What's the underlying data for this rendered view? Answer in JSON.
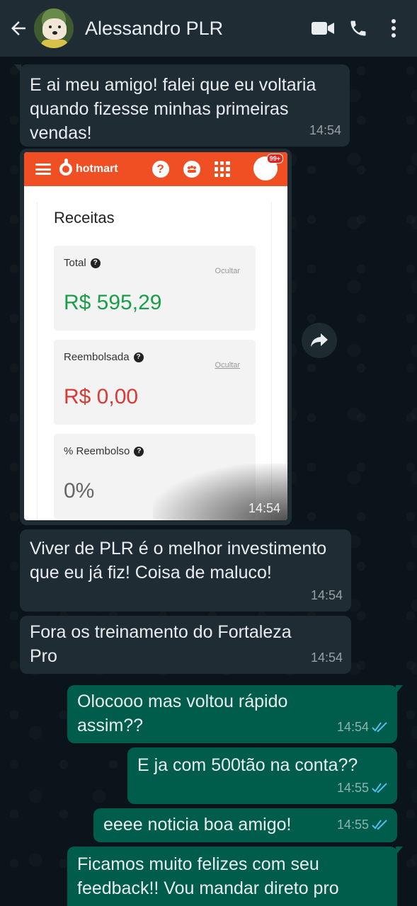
{
  "header": {
    "contact_name": "Alessandro PLR"
  },
  "messages": [
    {
      "dir": "in",
      "text": "E ai meu amigo! falei que eu voltaria quando fizesse minhas primeiras vendas!",
      "time": "14:54"
    },
    {
      "dir": "in",
      "type": "image",
      "time": "14:54"
    },
    {
      "dir": "in",
      "text": "Viver de PLR é o melhor investimento que eu já fiz! Coisa de maluco!",
      "time": "14:54"
    },
    {
      "dir": "in",
      "text": "Fora os treinamento do Fortaleza Pro",
      "time": "14:54"
    },
    {
      "dir": "out",
      "text": "Olocooo mas voltou rápido assim??",
      "time": "14:54",
      "status": "read"
    },
    {
      "dir": "out",
      "text": "E ja com 500tão na conta??",
      "time": "14:55",
      "status": "read"
    },
    {
      "dir": "out",
      "text": "eeee noticia boa amigo!",
      "time": "14:55",
      "status": "read"
    },
    {
      "dir": "out",
      "text": "Ficamos muito felizes com seu feedback!! Vou mandar direto pro",
      "time": ""
    }
  ],
  "screenshot": {
    "brand": "hotmart",
    "badge": "99+",
    "section_title": "Receitas",
    "cards": [
      {
        "label": "Total",
        "hide": "Ocultar",
        "value": "R$ 595,29"
      },
      {
        "label": "Reembolsada",
        "hide": "Ocultar",
        "value": "R$ 0,00"
      },
      {
        "label": "% Reembolso",
        "value": "0%"
      }
    ]
  },
  "colors": {
    "background": "#0b141a",
    "header": "#1f2c33",
    "incoming": "#1f2c33",
    "outgoing": "#005c4b",
    "read_ticks": "#53bdeb",
    "hotmart": "#f04e23"
  },
  "icons": [
    "back-arrow-icon",
    "video-call-icon",
    "phone-icon",
    "more-vertical-icon",
    "forward-icon",
    "double-check-icon"
  ]
}
